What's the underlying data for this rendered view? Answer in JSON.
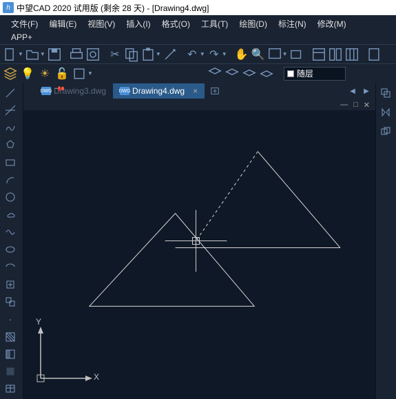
{
  "title": "中望CAD 2020 试用版 (剩余 28 天) - [Drawing4.dwg]",
  "menus": {
    "file": "文件(F)",
    "edit": "编辑(E)",
    "view": "视图(V)",
    "insert": "插入(I)",
    "format": "格式(O)",
    "tools": "工具(T)",
    "draw": "绘图(D)",
    "dimension": "标注(N)",
    "modify": "修改(M)",
    "app": "APP+"
  },
  "layer": {
    "name": "随层"
  },
  "tabs": {
    "inactive": "Drawing3.dwg",
    "active": "Drawing4.dwg",
    "close": "×",
    "dwg": "DWG"
  },
  "ucs": {
    "x": "X",
    "y": "Y"
  }
}
